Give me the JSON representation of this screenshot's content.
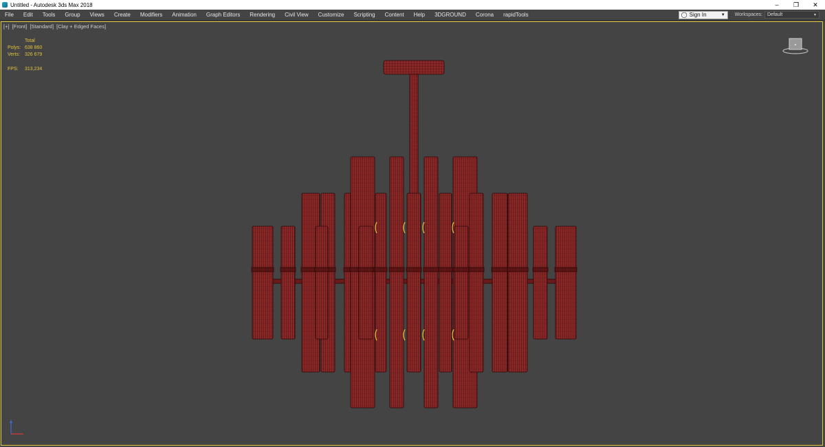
{
  "window": {
    "title": "Untitled - Autodesk 3ds Max 2018",
    "controls": [
      "–",
      "❐",
      "✕"
    ]
  },
  "menu": {
    "items": [
      "File",
      "Edit",
      "Tools",
      "Group",
      "Views",
      "Create",
      "Modifiers",
      "Animation",
      "Graph Editors",
      "Rendering",
      "Civil View",
      "Customize",
      "Scripting",
      "Content",
      "Help",
      "3DGROUND",
      "Corona",
      "rapidTools"
    ],
    "sign_in": "Sign In",
    "workspaces_label": "Workspaces:",
    "workspace_value": "Default"
  },
  "viewport": {
    "labels": [
      "[+]",
      "[Front]",
      "[Standard]",
      "[Clay + Edged Faces]"
    ],
    "stats": {
      "total_label": "Total",
      "polys_label": "Polys:",
      "polys": "638 860",
      "verts_label": "Verts:",
      "verts": "326 679",
      "fps_label": "FPS:",
      "fps": "313,234"
    }
  },
  "colors": {
    "accent": "#e2c43c",
    "mesh_fill": "#8c2a2a",
    "mesh_edge": "#2b0707",
    "viewport_bg": "#444444"
  }
}
